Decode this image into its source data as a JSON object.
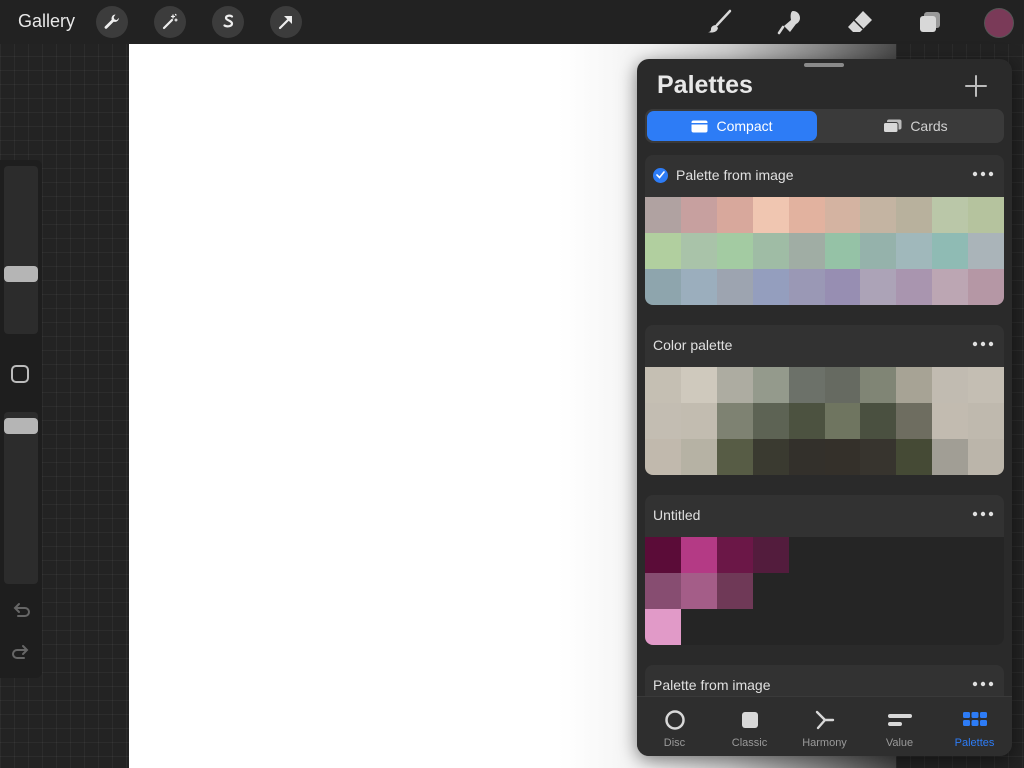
{
  "topbar": {
    "gallery_label": "Gallery",
    "left_tools": [
      "wrench-icon",
      "magic-wand-icon",
      "selection-icon",
      "arrow-icon"
    ],
    "right_tools": [
      "brush-icon",
      "smudge-icon",
      "eraser-icon",
      "layers-icon"
    ],
    "current_color": "#7a3a58"
  },
  "palettes_panel": {
    "title": "Palettes",
    "view_toggle": {
      "compact_label": "Compact",
      "cards_label": "Cards",
      "selected": "Compact"
    },
    "palettes": [
      {
        "name": "Palette from image",
        "default": true,
        "colors": [
          "#b0a2a1",
          "#c7a09f",
          "#d8a89c",
          "#f0c6b1",
          "#e2b29f",
          "#d4b3a1",
          "#c4b4a2",
          "#b8b19d",
          "#bac7a8",
          "#b5c39e",
          "#b1cf9f",
          "#a9c3a9",
          "#a3cba2",
          "#9fbca5",
          "#a0ada4",
          "#95c2a6",
          "#95b2ab",
          "#a0b8bb",
          "#8fbbb4",
          "#aab4b9",
          "#8ea5ad",
          "#9baebd",
          "#9da4b0",
          "#949ebe",
          "#9a98b5",
          "#978eb2",
          "#aca3b7",
          "#a995af",
          "#bca6b3",
          "#b597a5"
        ]
      },
      {
        "name": "Color palette",
        "default": false,
        "colors": [
          "#c5bfb3",
          "#cfc9bd",
          "#adaca1",
          "#949a8c",
          "#6c7169",
          "#666a61",
          "#808575",
          "#a7a395",
          "#c1bbb1",
          "#c4beb3",
          "#c3bdb2",
          "#c2bcb0",
          "#7e8272",
          "#5d6354",
          "#4c5240",
          "#6f7560",
          "#4a5040",
          "#6e6d60",
          "#c2bbb0",
          "#bfb9ae",
          "#c1b9ad",
          "#b6b2a4",
          "#575c45",
          "#3a3a30",
          "#33302b",
          "#34302a",
          "#37342e",
          "#454a35",
          "#a19e95",
          "#bbb5aa"
        ]
      },
      {
        "name": "Untitled",
        "default": false,
        "colors": [
          "#5b0c38",
          "#b43a85",
          "#6b1747",
          "#531c3d",
          "",
          "",
          "",
          "",
          "",
          "",
          "#874d71",
          "#a45d88",
          "#6f3957",
          "",
          "",
          "",
          "",
          "",
          "",
          "",
          "#e19ac8",
          "",
          "",
          "",
          "",
          "",
          "",
          "",
          "",
          ""
        ]
      },
      {
        "name": "Palette from image",
        "default": false,
        "colors": []
      }
    ],
    "bottom_tabs": [
      {
        "label": "Disc",
        "icon": "disc-icon",
        "active": false
      },
      {
        "label": "Classic",
        "icon": "classic-icon",
        "active": false
      },
      {
        "label": "Harmony",
        "icon": "harmony-icon",
        "active": false
      },
      {
        "label": "Value",
        "icon": "value-icon",
        "active": false
      },
      {
        "label": "Palettes",
        "icon": "palettes-icon",
        "active": true
      }
    ]
  }
}
